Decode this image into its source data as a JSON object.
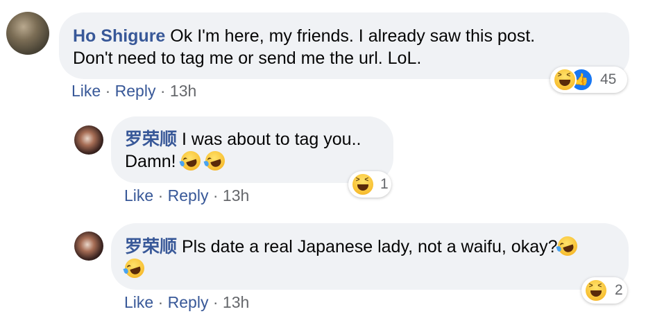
{
  "comments": [
    {
      "author": "Ho Shigure",
      "text": "Ok I'm here, my friends. I already saw this post.",
      "text_line2": "Don't need to tag me or send me the url. LoL.",
      "like_label": "Like",
      "reply_label": "Reply",
      "time": "13h",
      "reaction_count": "45",
      "reactions": [
        "haha-icon",
        "like-icon"
      ]
    },
    {
      "author": "罗荣顺",
      "text": "I was about to tag you..",
      "text_line2": "Damn!",
      "like_label": "Like",
      "reply_label": "Reply",
      "time": "13h",
      "reaction_count": "1",
      "reactions": [
        "haha-icon"
      ]
    },
    {
      "author": "罗荣顺",
      "text": "Pls date a real Japanese lady, not a waifu, okay?",
      "like_label": "Like",
      "reply_label": "Reply",
      "time": "13h",
      "reaction_count": "2",
      "reactions": [
        "haha-icon"
      ]
    }
  ],
  "separator": "·",
  "colors": {
    "bubble": "#f0f2f5",
    "link": "#385898",
    "muted": "#65676b"
  }
}
